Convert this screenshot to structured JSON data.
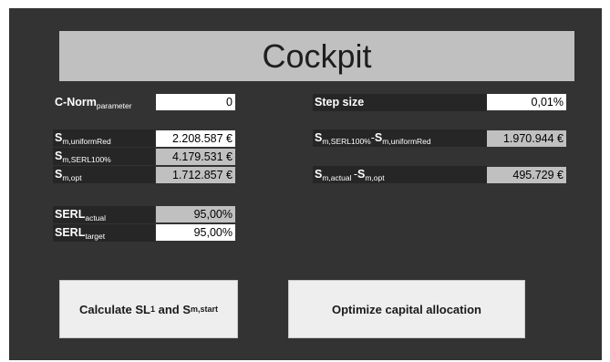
{
  "title": "Cockpit",
  "c_norm": {
    "label": "C-Norm",
    "sub": "parameter",
    "value": "0"
  },
  "step_size": {
    "label": "Step size",
    "value": "0,01%"
  },
  "s_uniform": {
    "label": "S",
    "sub": "m,uniformRed",
    "value": "2.208.587 €"
  },
  "s_serl100": {
    "label": "S",
    "sub": "m,SERL100%",
    "value": "4.179.531 €"
  },
  "s_opt": {
    "label": "S",
    "sub": "m,opt",
    "value": "1.712.857 €"
  },
  "diff_serl_uniform": {
    "label_a": "S",
    "sub_a": "m,SERL100%",
    "sep": "-",
    "label_b": "S",
    "sub_b": "m,uniformRed",
    "value": "1.970.944 €"
  },
  "diff_actual_opt": {
    "label_a": "S",
    "sub_a": "m,actual ",
    "sep": "-",
    "label_b": "S",
    "sub_b": "m,opt",
    "value": "495.729 €"
  },
  "serl_actual": {
    "label": "SERL",
    "sub": "actual",
    "value": "95,00%"
  },
  "serl_target": {
    "label": "SERL",
    "sub": "target",
    "value": "95,00%"
  },
  "btn_calculate": {
    "label": "Calculate SL",
    "sub1": "1",
    "mid": " and S",
    "sub2": "m,start"
  },
  "btn_optimize": {
    "label": "Optimize capital allocation"
  }
}
